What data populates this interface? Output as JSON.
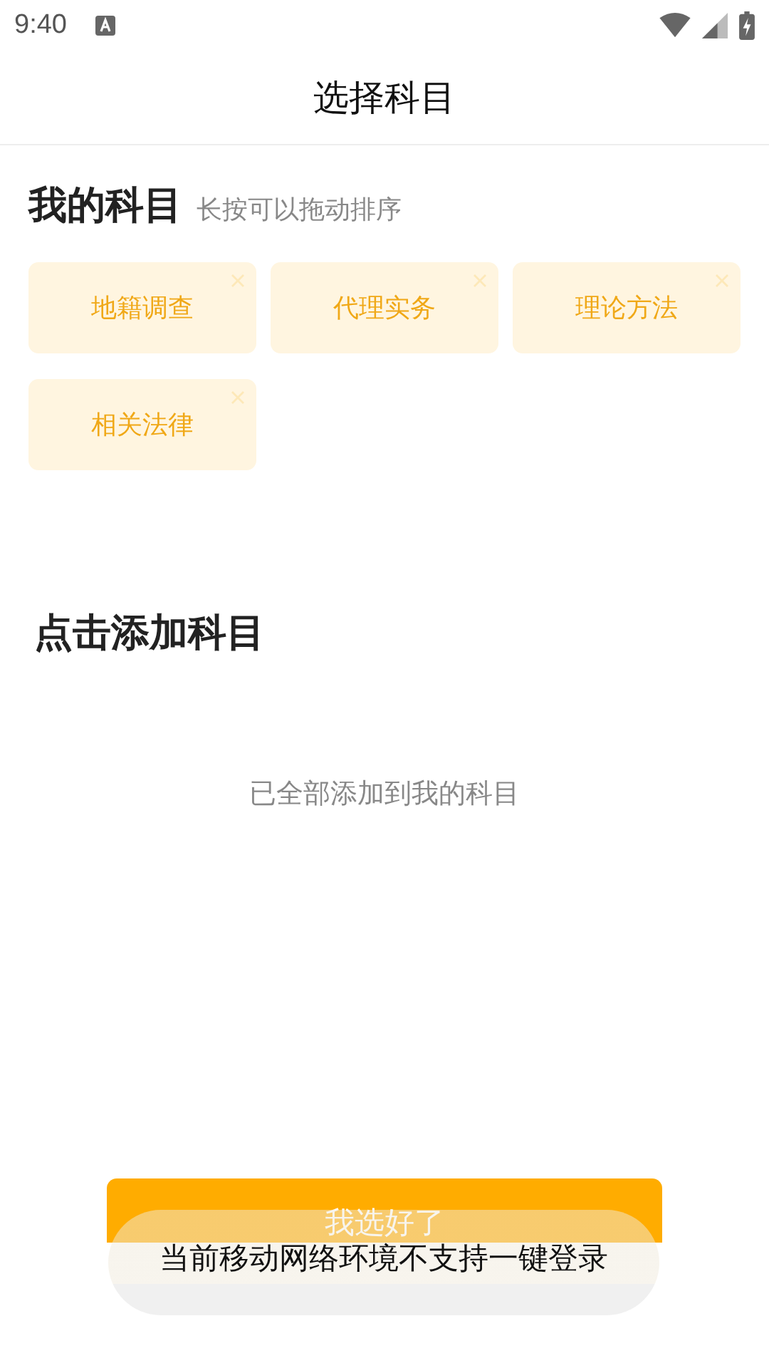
{
  "status_bar": {
    "time": "9:40"
  },
  "header": {
    "title": "选择科目"
  },
  "my_subjects": {
    "title": "我的科目",
    "hint": "长按可以拖动排序",
    "items": [
      {
        "label": "地籍调查"
      },
      {
        "label": "代理实务"
      },
      {
        "label": "理论方法"
      },
      {
        "label": "相关法律"
      }
    ]
  },
  "add_subjects": {
    "title": "点击添加科目",
    "empty_text": "已全部添加到我的科目"
  },
  "confirm_button": {
    "label": "我选好了"
  },
  "toast": {
    "text": "当前移动网络环境不支持一键登录"
  }
}
